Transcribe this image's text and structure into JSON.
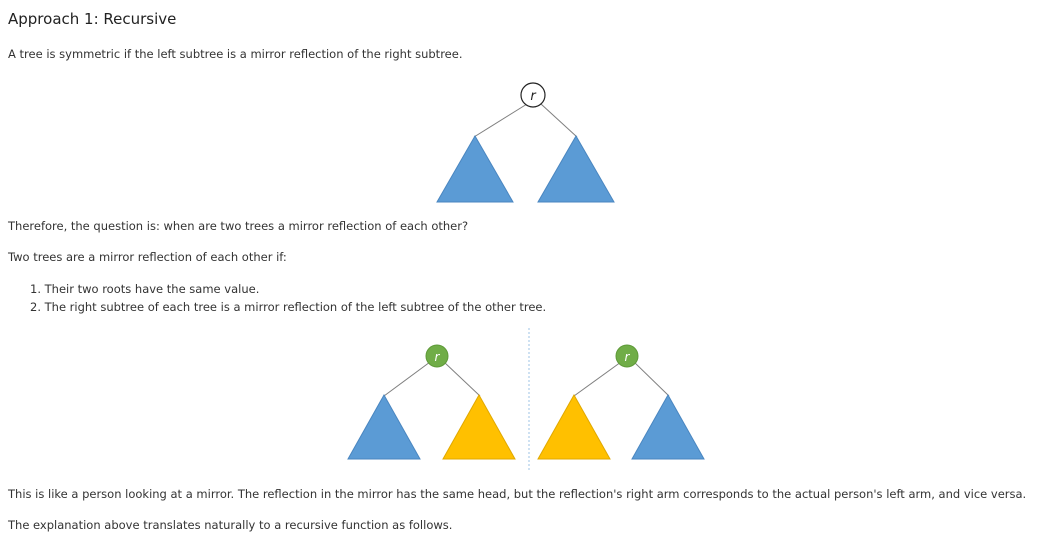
{
  "heading": "Approach 1: Recursive",
  "intro": "A tree is symmetric if the left subtree is a mirror reflection of the right subtree.",
  "diagram1": {
    "root_label": "r"
  },
  "question": "Therefore, the question is: when are two trees a mirror reflection of each other?",
  "condition_intro": "Two trees are a mirror reflection of each other if:",
  "conditions": [
    "1. Their two roots have the same value.",
    "2. The right subtree of each tree is a mirror reflection of the left subtree of the other tree."
  ],
  "diagram2": {
    "left_root_label": "r",
    "right_root_label": "r"
  },
  "analogy": "This is like a person looking at a mirror. The reflection in the mirror has the same head, but the reflection's right arm corresponds to the actual person's left arm, and vice versa.",
  "conclusion": "The explanation above translates naturally to a recursive function as follows.",
  "colors": {
    "blue_subtree": "#5B9BD5",
    "yellow_subtree": "#FFC000",
    "green_root": "#70AD47",
    "white_root": "#FFFFFF",
    "mirror_line": "#9DC3E6"
  }
}
